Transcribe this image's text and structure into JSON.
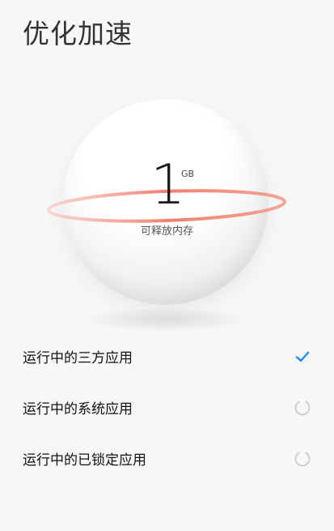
{
  "header": {
    "title": "优化加速"
  },
  "memory": {
    "value": "1",
    "unit": "GB",
    "label": "可释放内存",
    "ring_color": "#f08070"
  },
  "scan_items": [
    {
      "label": "运行中的三方应用",
      "status": "done",
      "icon": "checkmark-icon"
    },
    {
      "label": "运行中的系统应用",
      "status": "scanning",
      "icon": "loading-spinner-icon"
    },
    {
      "label": "运行中的已锁定应用",
      "status": "scanning",
      "icon": "loading-spinner-icon"
    }
  ],
  "colors": {
    "accent": "#1a8cff",
    "spinner": "#c8c8c8"
  }
}
